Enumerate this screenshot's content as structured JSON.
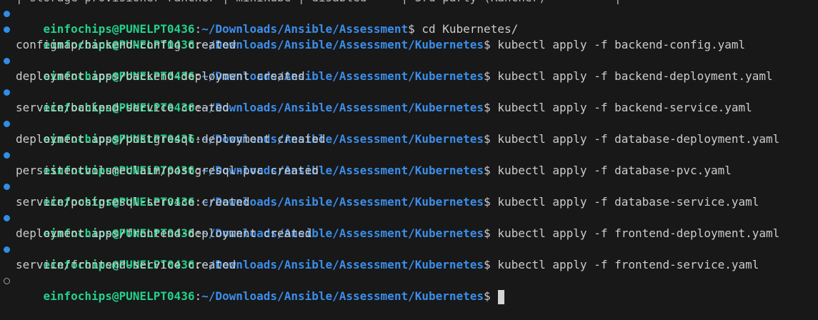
{
  "terminal": {
    "partial_top_line": "| storage-provisioner-rancher | minikube | disabled     | 3rd party (Rancher)          |",
    "prompt": {
      "user_host": "einfochips@PUNELPT0436",
      "separator": ":",
      "symbol": "$",
      "path_assessment": "~/Downloads/Ansible/Assessment",
      "path_kubernetes": "~/Downloads/Ansible/Assessment/Kubernetes"
    },
    "entries": [
      {
        "command": "cd Kubernetes/",
        "output": ""
      },
      {
        "command": "kubectl apply -f backend-config.yaml",
        "output": "configmap/backend-config created"
      },
      {
        "command": "kubectl apply -f backend-deployment.yaml",
        "output": "deployment.apps/backend-deployment created"
      },
      {
        "command": "kubectl apply -f backend-service.yaml",
        "output": "service/backend-service created"
      },
      {
        "command": "kubectl apply -f database-deployment.yaml",
        "output": "deployment.apps/postgresql-deployment created"
      },
      {
        "command": "kubectl apply -f database-pvc.yaml",
        "output": "persistentvolumeclaim/postgresql-pvc created"
      },
      {
        "command": "kubectl apply -f database-service.yaml",
        "output": "service/postgresql-service created"
      },
      {
        "command": "kubectl apply -f frontend-deployment.yaml",
        "output": "deployment.apps/frontend-deployment created"
      },
      {
        "command": "kubectl apply -f frontend-service.yaml",
        "output": "service/frontend-service created"
      }
    ],
    "colors": {
      "background": "#181818",
      "user_host": "#23d18b",
      "path": "#3b8eea",
      "text": "#cccccc",
      "success_dot": "#2f8ee6"
    }
  }
}
